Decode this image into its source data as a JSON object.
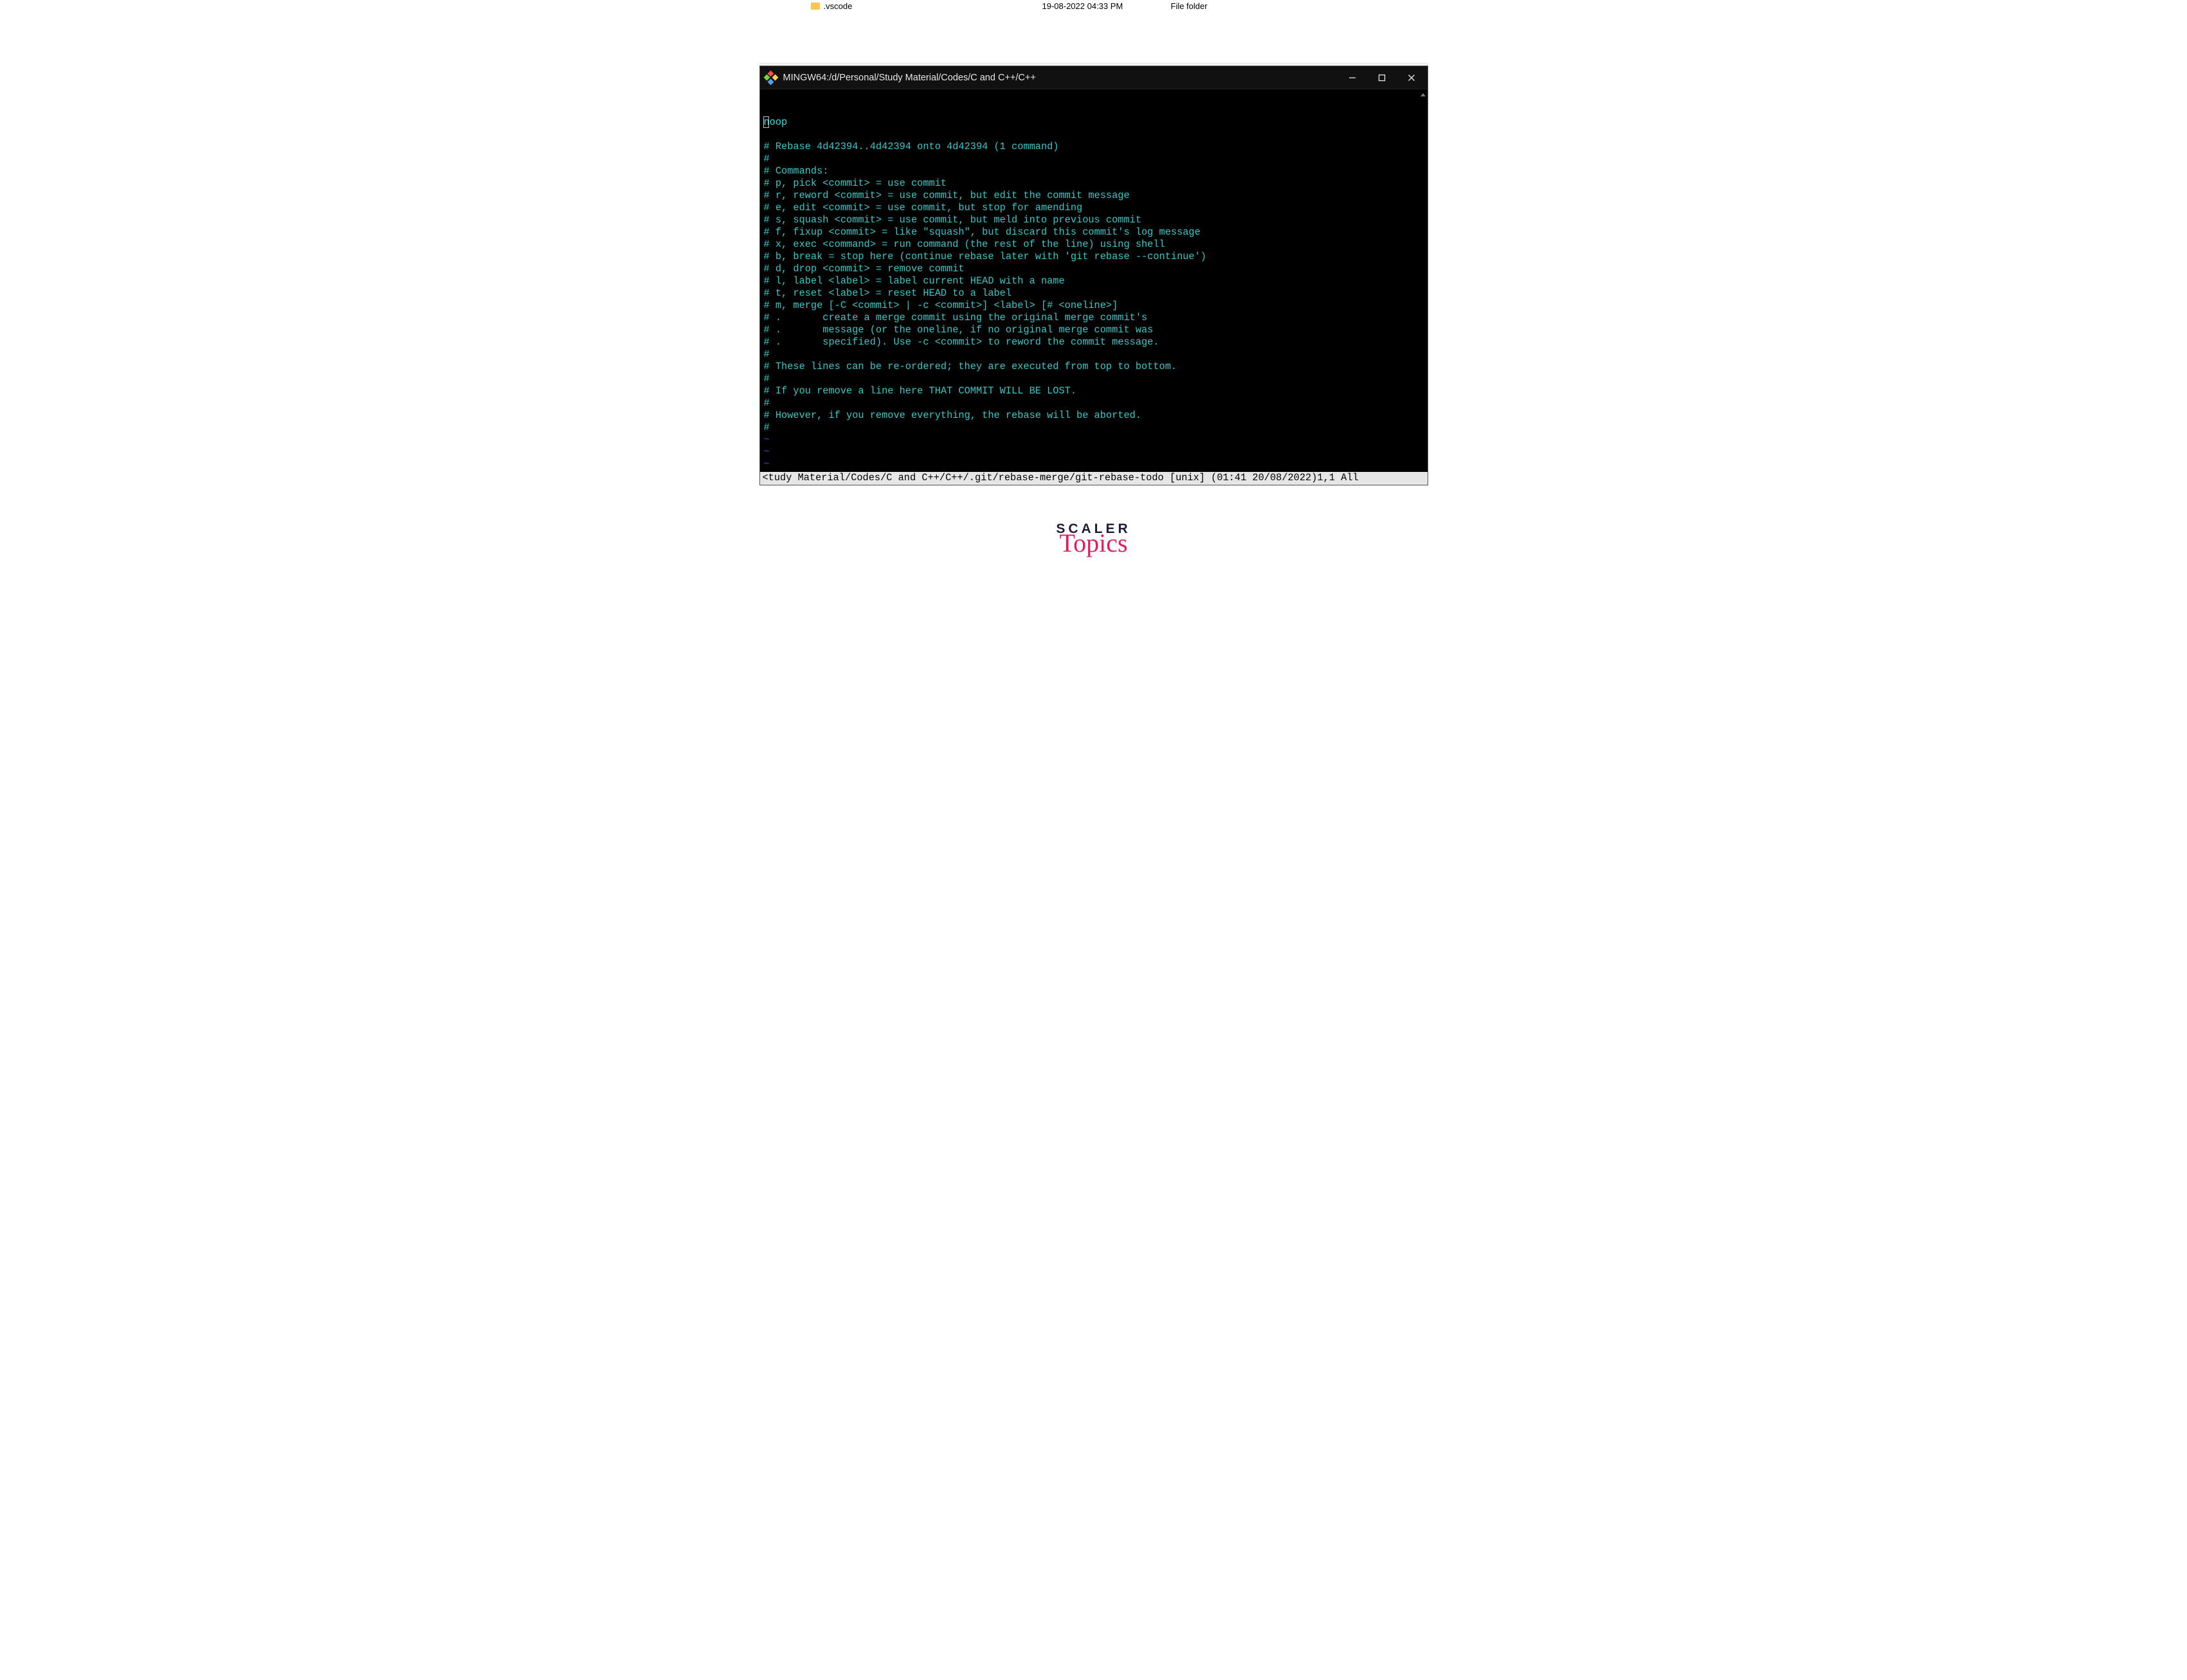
{
  "bg": {
    "vscode_label": ".vscode",
    "date_col": "19-08-2022 04:33 PM",
    "type_col": "File folder"
  },
  "window": {
    "title": "MINGW64:/d/Personal/Study Material/Codes/C and C++/C++"
  },
  "editor": {
    "first_word": "noop",
    "lines": [
      "",
      "# Rebase 4d42394..4d42394 onto 4d42394 (1 command)",
      "#",
      "# Commands:",
      "# p, pick <commit> = use commit",
      "# r, reword <commit> = use commit, but edit the commit message",
      "# e, edit <commit> = use commit, but stop for amending",
      "# s, squash <commit> = use commit, but meld into previous commit",
      "# f, fixup <commit> = like \"squash\", but discard this commit's log message",
      "# x, exec <command> = run command (the rest of the line) using shell",
      "# b, break = stop here (continue rebase later with 'git rebase --continue')",
      "# d, drop <commit> = remove commit",
      "# l, label <label> = label current HEAD with a name",
      "# t, reset <label> = reset HEAD to a label",
      "# m, merge [-C <commit> | -c <commit>] <label> [# <oneline>]",
      "# .       create a merge commit using the original merge commit's",
      "# .       message (or the oneline, if no original merge commit was",
      "# .       specified). Use -c <commit> to reword the commit message.",
      "#",
      "# These lines can be re-ordered; they are executed from top to bottom.",
      "#",
      "# If you remove a line here THAT COMMIT WILL BE LOST.",
      "#",
      "# However, if you remove everything, the rebase will be aborted.",
      "#"
    ],
    "tildes": [
      "~",
      "~",
      "~"
    ]
  },
  "status": {
    "path": "<tudy Material/Codes/C and C++/C++/.git/rebase-merge/git-rebase-todo",
    "format": "[unix]",
    "time": "(01:41 20/08/2022)",
    "pos": "1,1",
    "scroll": "All"
  },
  "brand": {
    "line1": "SCALER",
    "line2": "Topics"
  }
}
